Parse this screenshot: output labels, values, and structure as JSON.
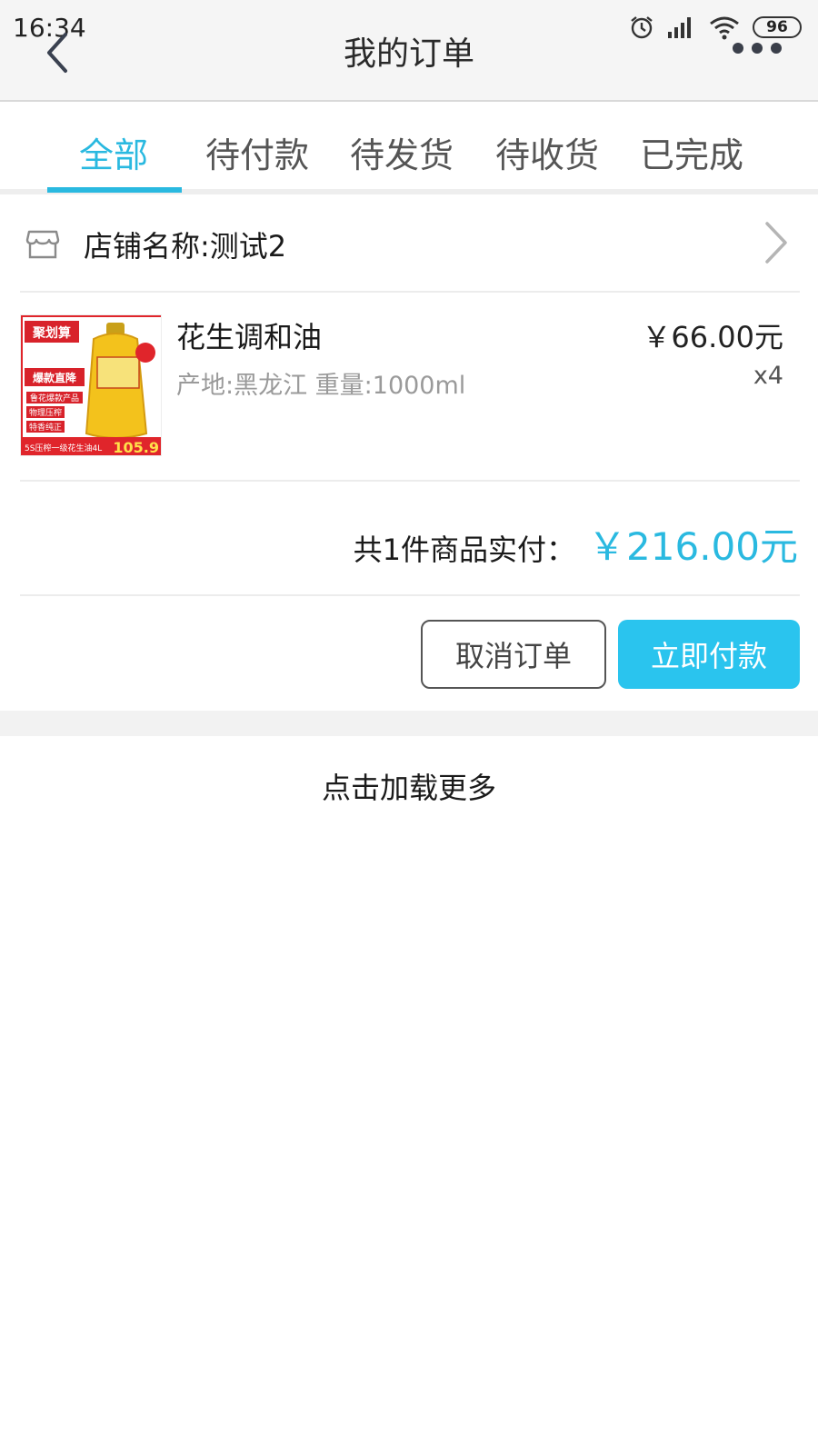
{
  "status_bar": {
    "time": "16:34",
    "battery": "96"
  },
  "header": {
    "title": "我的订单"
  },
  "tabs": [
    {
      "label": "全部",
      "active": true
    },
    {
      "label": "待付款",
      "active": false
    },
    {
      "label": "待发货",
      "active": false
    },
    {
      "label": "待收货",
      "active": false
    },
    {
      "label": "已完成",
      "active": false
    }
  ],
  "order": {
    "shop_name": "店铺名称:测试2",
    "product": {
      "name": "花生调和油",
      "spec": "产地:黑龙江 重量:1000ml",
      "price": "￥66.00元",
      "quantity": "x4",
      "thumb_texts": {
        "brand_banner": "聚划算",
        "promo_title": "爆款直降",
        "promo_line1": "鲁花爆款产品",
        "promo_line2": "物理压榨",
        "promo_line3": "特香纯正",
        "bottom_text": "5S压榨一级花生油4L",
        "price_tag": "105.9"
      }
    },
    "total_label": "共1件商品实付：",
    "total_amount": "￥216.00元",
    "cancel_button": "取消订单",
    "pay_button": "立即付款"
  },
  "load_more": "点击加载更多",
  "colors": {
    "accent": "#2ab9e0",
    "pay_button": "#2ac4ee",
    "header_bg": "#f5f5f5"
  },
  "icons": {
    "back": "chevron-left-icon",
    "more": "more-dots-icon",
    "shop": "store-icon",
    "shop_chevron": "chevron-right-icon",
    "alarm": "alarm-icon",
    "signal": "signal-icon",
    "wifi": "wifi-icon"
  }
}
